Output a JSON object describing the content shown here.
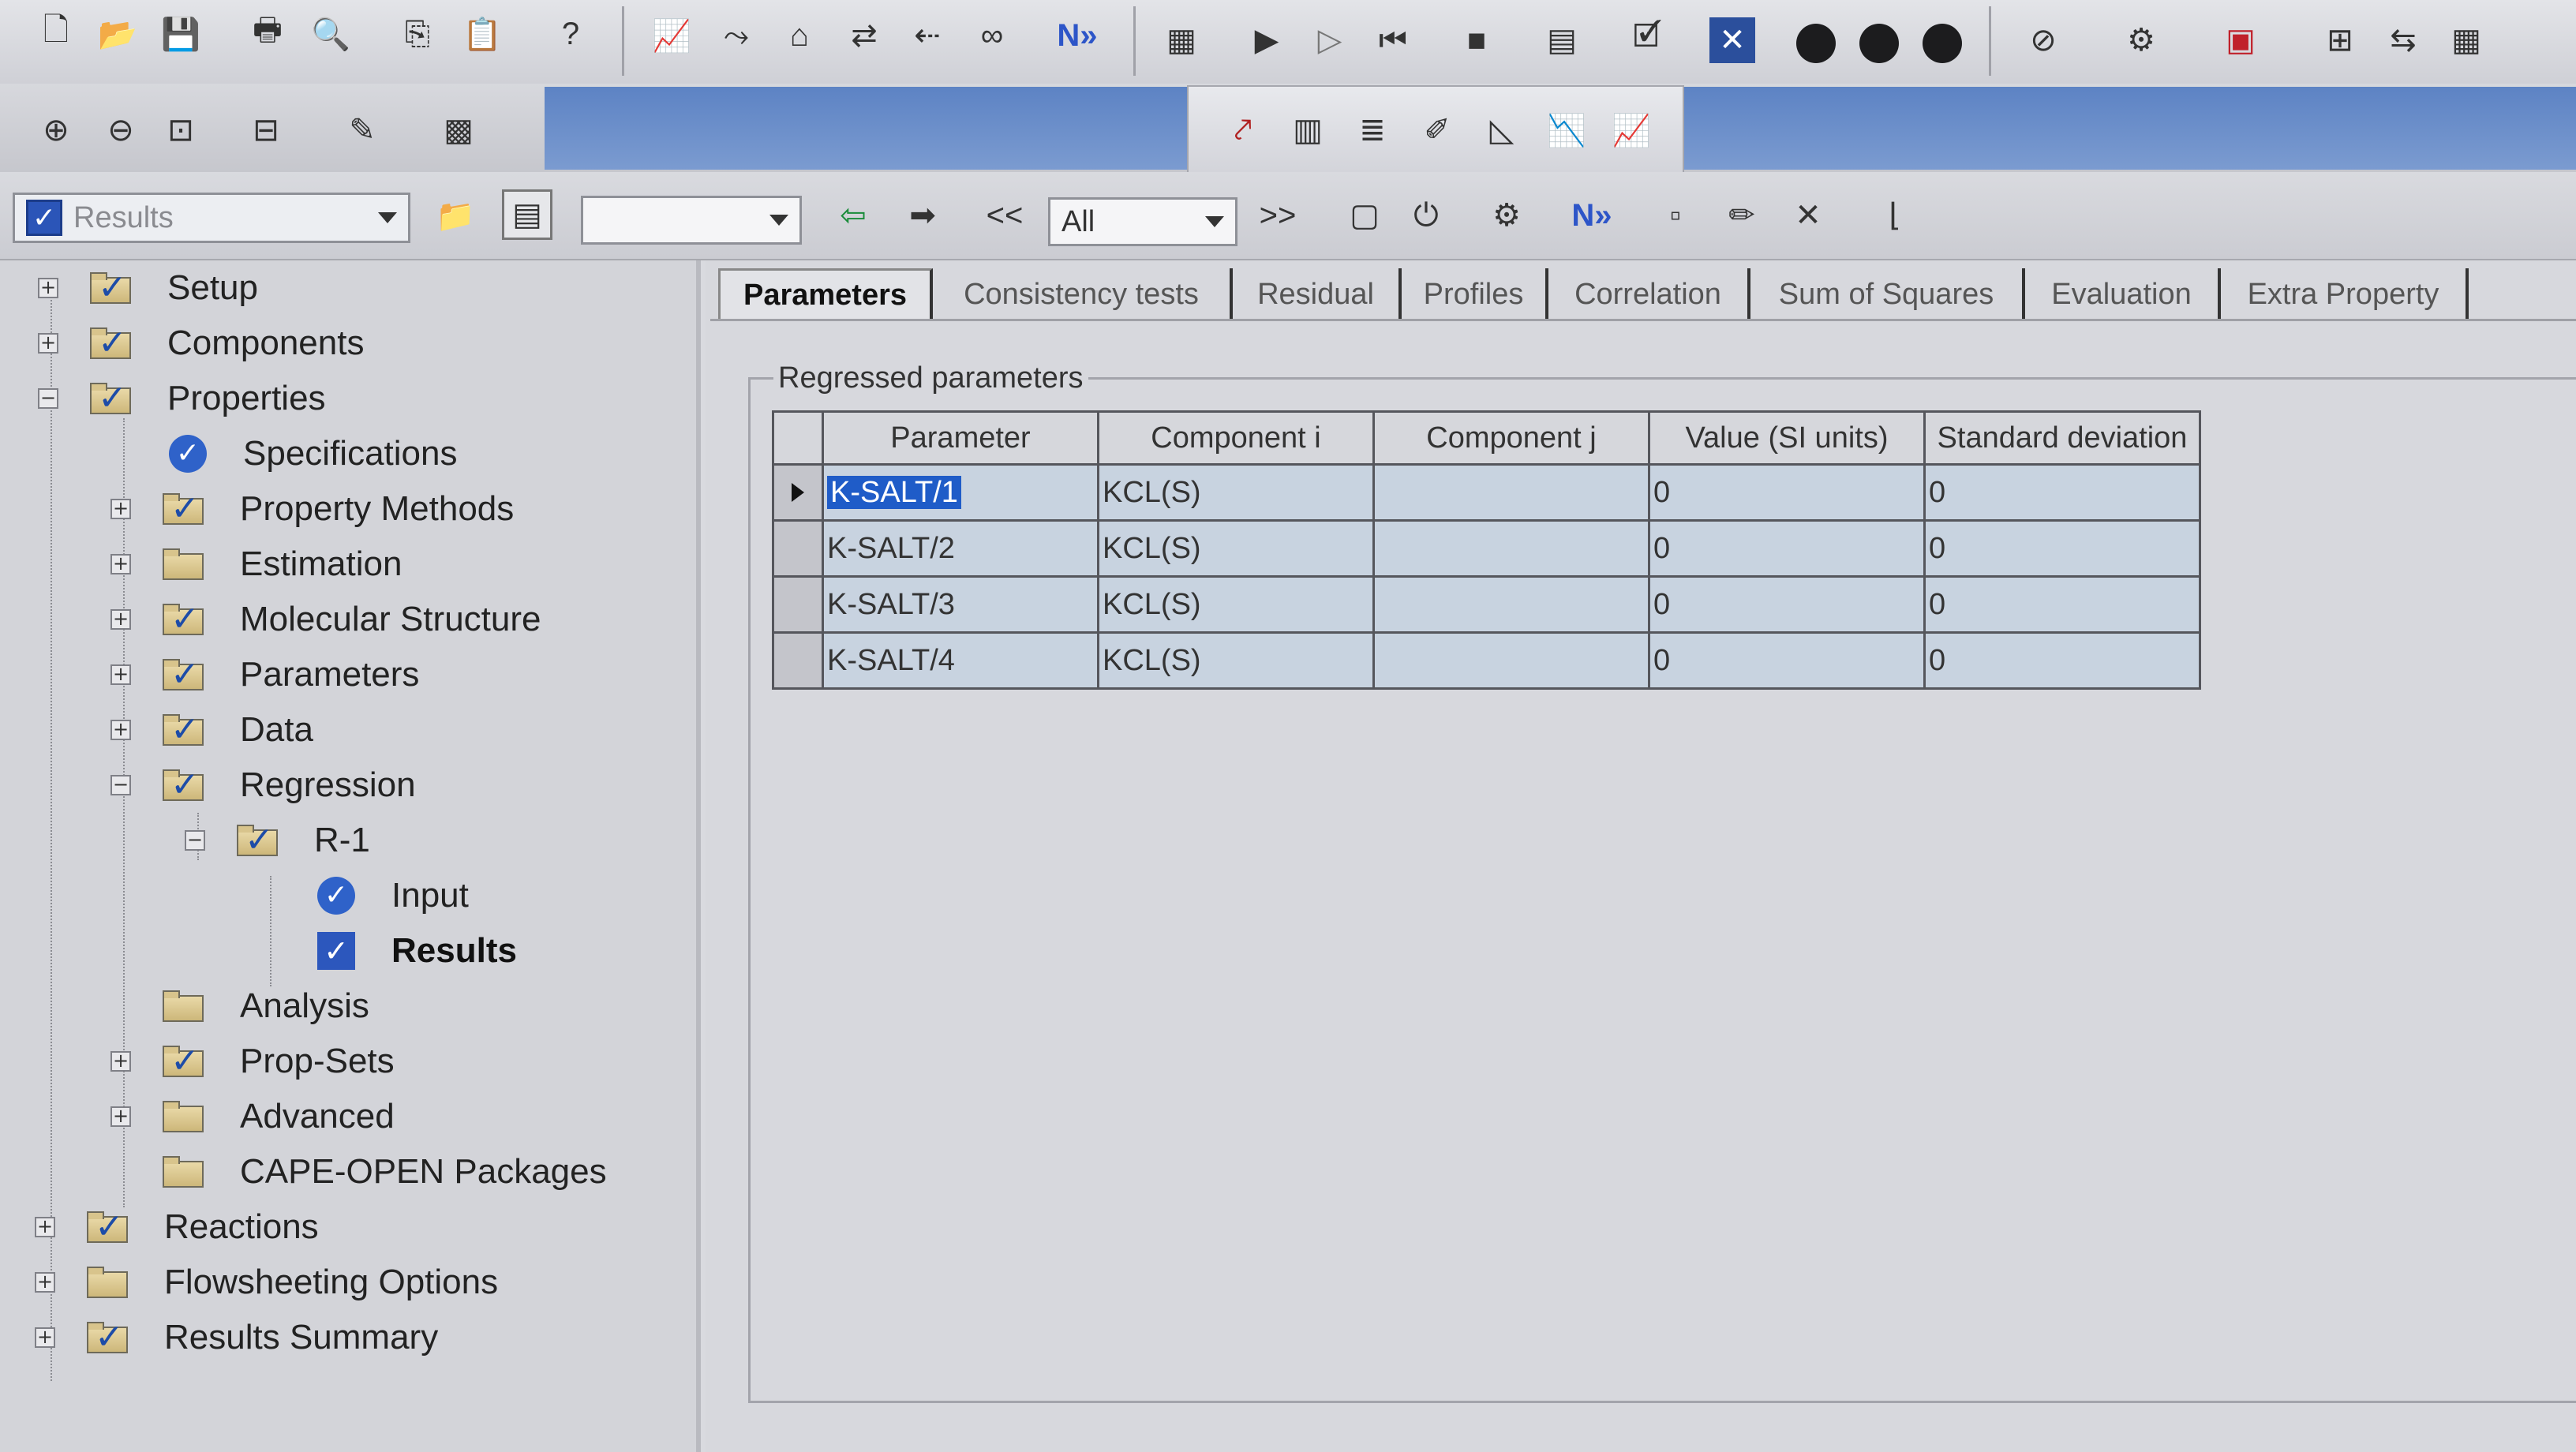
{
  "nav": {
    "results_combo": "Results",
    "filter_combo": "All",
    "prev_label": "<<",
    "next_label": ">>"
  },
  "tree": {
    "items": [
      {
        "label": "Setup"
      },
      {
        "label": "Components"
      },
      {
        "label": "Properties"
      },
      {
        "label": "Specifications"
      },
      {
        "label": "Property Methods"
      },
      {
        "label": "Estimation"
      },
      {
        "label": "Molecular Structure"
      },
      {
        "label": "Parameters"
      },
      {
        "label": "Data"
      },
      {
        "label": "Regression"
      },
      {
        "label": "R-1"
      },
      {
        "label": "Input"
      },
      {
        "label": "Results"
      },
      {
        "label": "Analysis"
      },
      {
        "label": "Prop-Sets"
      },
      {
        "label": "Advanced"
      },
      {
        "label": "CAPE-OPEN Packages"
      },
      {
        "label": "Reactions"
      },
      {
        "label": "Flowsheeting Options"
      },
      {
        "label": "Results Summary"
      }
    ]
  },
  "tabs": [
    {
      "label": "Parameters"
    },
    {
      "label": "Consistency tests"
    },
    {
      "label": "Residual"
    },
    {
      "label": "Profiles"
    },
    {
      "label": "Correlation"
    },
    {
      "label": "Sum of Squares"
    },
    {
      "label": "Evaluation"
    },
    {
      "label": "Extra Property"
    }
  ],
  "group_title": "Regressed parameters",
  "table": {
    "headers": [
      "Parameter",
      "Component i",
      "Component j",
      "Value (SI units)",
      "Standard deviation"
    ],
    "rows": [
      [
        "K-SALT/1",
        "KCL(S)",
        "",
        "0",
        "0"
      ],
      [
        "K-SALT/2",
        "KCL(S)",
        "",
        "0",
        "0"
      ],
      [
        "K-SALT/3",
        "KCL(S)",
        "",
        "0",
        "0"
      ],
      [
        "K-SALT/4",
        "KCL(S)",
        "",
        "0",
        "0"
      ]
    ]
  },
  "colors": {
    "selection": "#1f5cc8",
    "toolbar_band": "#6a8ccb",
    "check_blue": "#2c57bd"
  }
}
